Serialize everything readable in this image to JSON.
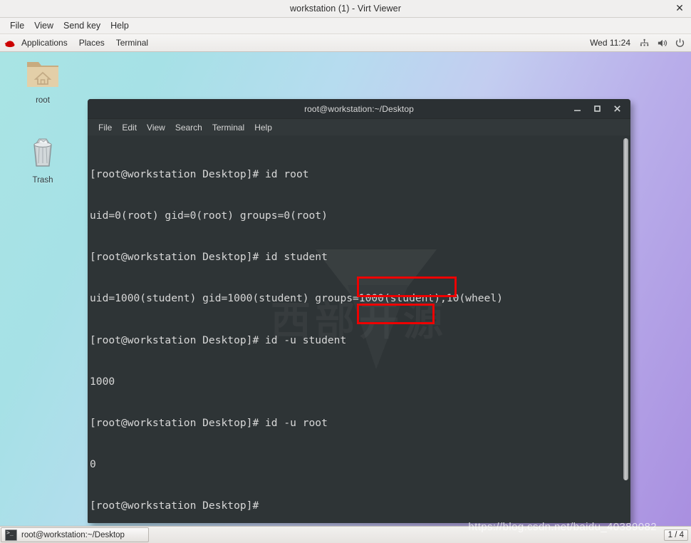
{
  "viewer": {
    "title": "workstation (1) - Virt Viewer",
    "close_label": "✕",
    "menu": [
      "File",
      "View",
      "Send key",
      "Help"
    ]
  },
  "guest_panel": {
    "applications_label": "Applications",
    "places_label": "Places",
    "terminal_label": "Terminal",
    "clock": "Wed 11:24",
    "tray": [
      "network-icon",
      "volume-icon",
      "power-icon"
    ]
  },
  "desktop": {
    "icons": [
      {
        "name": "root",
        "label": "root",
        "type": "home-folder-icon"
      },
      {
        "name": "trash",
        "label": "Trash",
        "type": "trash-icon"
      }
    ],
    "background_start": "#a9e4e4",
    "background_end": "#a98fe0"
  },
  "terminal": {
    "title": "root@workstation:~/Desktop",
    "controls": {
      "minimize": "–",
      "maximize": "□",
      "close": "✕"
    },
    "menu": [
      "File",
      "Edit",
      "View",
      "Search",
      "Terminal",
      "Help"
    ],
    "watermark": "西部开源",
    "background": "#2e3436",
    "foreground": "#d8d8d8",
    "lines": [
      "[root@workstation Desktop]# id root",
      "uid=0(root) gid=0(root) groups=0(root)",
      "[root@workstation Desktop]# id student",
      "uid=1000(student) gid=1000(student) groups=1000(student),10(wheel)",
      "[root@workstation Desktop]# id -u student",
      "1000",
      "[root@workstation Desktop]# id -u root",
      "0",
      "[root@workstation Desktop]#"
    ],
    "annotations": [
      {
        "name": "id-u-student-highlight",
        "text": "id -u student",
        "color": "#ee0000"
      },
      {
        "name": "id-u-root-highlight",
        "text": "id -u root",
        "color": "#ee0000"
      }
    ]
  },
  "taskbar": {
    "window_button_label": "root@workstation:~/Desktop",
    "workspace_indicator": "1 / 4"
  },
  "watermark": {
    "url": "https://blog.csdn.net/baidu_40389082"
  }
}
